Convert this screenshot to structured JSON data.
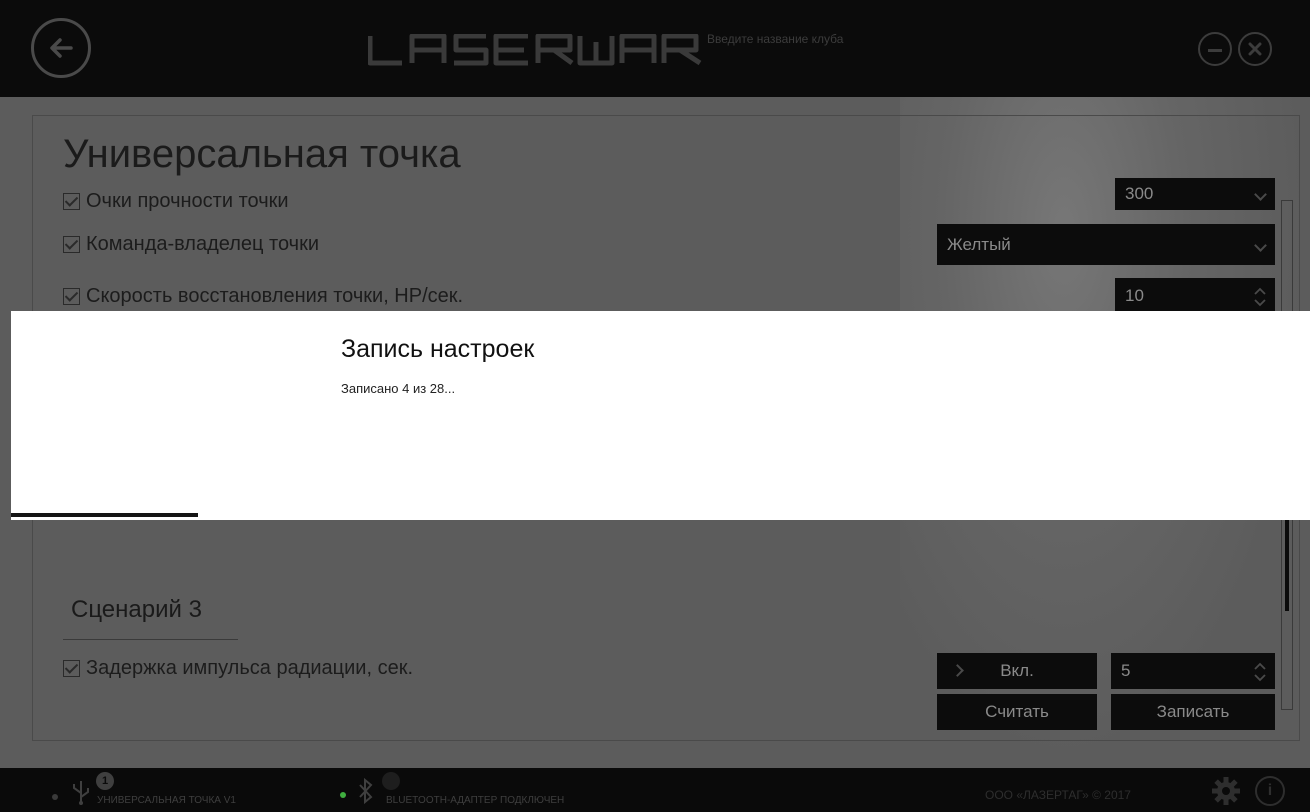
{
  "titlebar": {
    "logo_text": "LASERWAR",
    "club_placeholder": "Введите название клуба"
  },
  "panel": {
    "title": "Универсальная точка",
    "rows": [
      {
        "label": "Очки прочности точки",
        "control": "300"
      },
      {
        "label": "Команда-владелец точки",
        "control": "Желтый"
      },
      {
        "label": "Скорость восстановления точки, HP/сек.",
        "control": "10"
      }
    ],
    "scenario": {
      "title": "Сценарий 3",
      "row_label": "Задержка импульса радиации, сек.",
      "toggle_label": "Вкл.",
      "value": "5"
    },
    "read_button": "Считать",
    "write_button": "Записать"
  },
  "modal": {
    "title": "Запись настроек",
    "status": "Записано 4 из 28...",
    "progress": {
      "written": 4,
      "total": 28
    }
  },
  "statusbar": {
    "device_label": "УНИВЕРСАЛЬНАЯ ТОЧКА V1",
    "device_badge": "1",
    "bluetooth_label": "BLUETOOTH-АДАПТЕР ПОДКЛЮЧЕН",
    "copyright": "ООО «ЛАЗЕРТАГ» © 2017"
  },
  "colors": {
    "accent_green": "#3fae3f",
    "panel_bg": "#5c5c5c",
    "dark": "#0c0c0c"
  },
  "icons": [
    "back-arrow-icon",
    "minimize-icon",
    "close-icon",
    "checkbox-icon",
    "chevron-down-icon",
    "updown-arrows-icon",
    "chevron-right-icon",
    "usb-icon",
    "bluetooth-icon",
    "gear-icon",
    "info-icon"
  ]
}
